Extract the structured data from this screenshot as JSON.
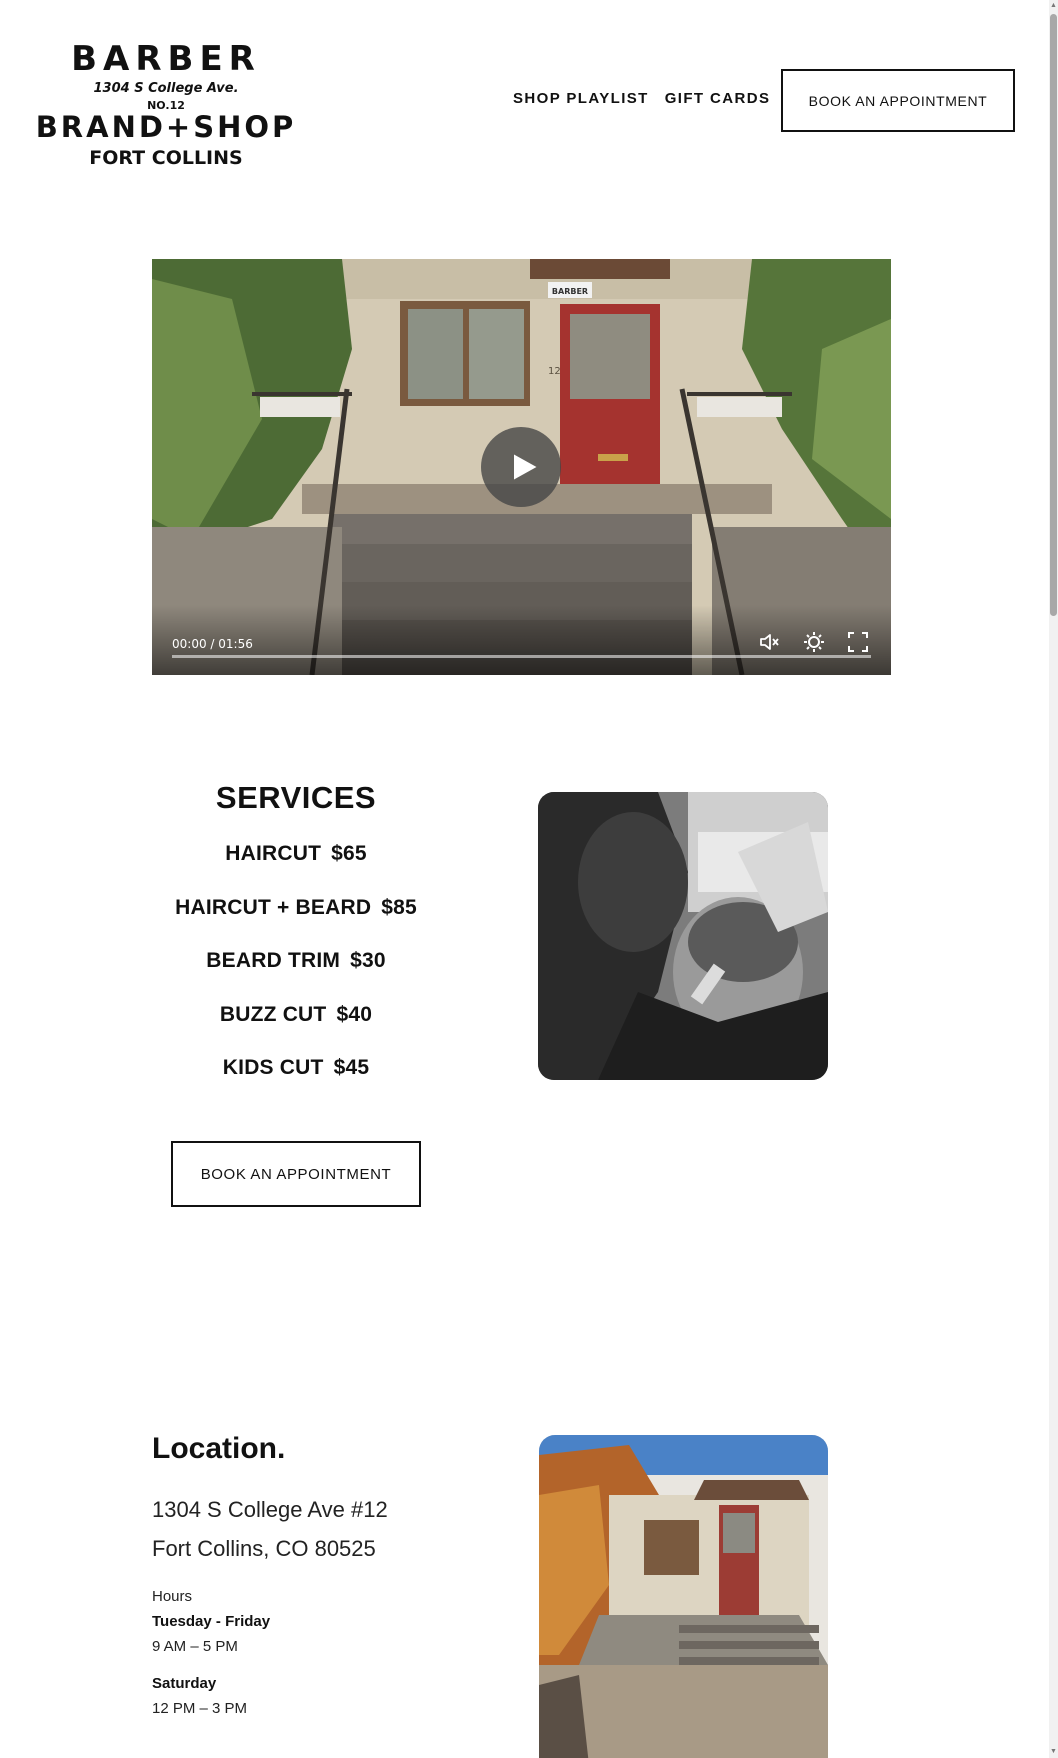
{
  "logo": {
    "top_word": "BARBER",
    "address_line": "1304 S College Ave.",
    "number": "NO.12",
    "brand_line": "BRAND+SHOP",
    "city": "FORT COLLINS"
  },
  "nav": {
    "items": [
      {
        "label": "SHOP PLAYLIST"
      },
      {
        "label": "GIFT CARDS"
      }
    ],
    "cta_label": "BOOK AN APPOINTMENT"
  },
  "video": {
    "time_display": "00:00 / 01:56",
    "progress": 0,
    "sign_text": "BARBER",
    "door_number": "12"
  },
  "services": {
    "title": "SERVICES",
    "items": [
      {
        "name": "HAIRCUT",
        "price": "$65"
      },
      {
        "name": "HAIRCUT + BEARD",
        "price": "$85"
      },
      {
        "name": "BEARD TRIM",
        "price": "$30"
      },
      {
        "name": "BUZZ CUT",
        "price": "$40"
      },
      {
        "name": "KIDS CUT",
        "price": "$45"
      }
    ],
    "cta_label": "BOOK AN APPOINTMENT"
  },
  "location": {
    "title": "Location.",
    "address_line1": "1304 S College Ave #12",
    "address_line2": "Fort Collins, CO 80525",
    "hours_label": "Hours",
    "hours": [
      {
        "day": "Tuesday - Friday",
        "time": "9 AM – 5 PM"
      },
      {
        "day": "Saturday",
        "time": "12 PM – 3 PM"
      }
    ]
  },
  "colors": {
    "text": "#111111",
    "door_red": "#b23a36",
    "background": "#ffffff"
  }
}
